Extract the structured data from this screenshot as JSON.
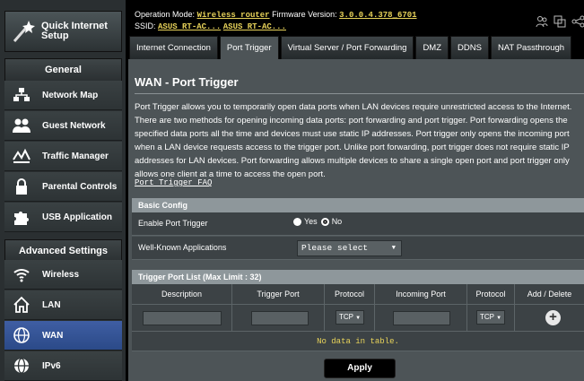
{
  "sidebar": {
    "quick_setup": "Quick Internet Setup",
    "general_heading": "General",
    "general_items": [
      {
        "label": "Network Map",
        "icon": "network-map-icon"
      },
      {
        "label": "Guest Network",
        "icon": "guest-network-icon"
      },
      {
        "label": "Traffic Manager",
        "icon": "traffic-manager-icon"
      },
      {
        "label": "Parental Controls",
        "icon": "lock-icon"
      },
      {
        "label": "USB Application",
        "icon": "puzzle-icon"
      }
    ],
    "advanced_heading": "Advanced Settings",
    "advanced_items": [
      {
        "label": "Wireless",
        "icon": "wifi-icon"
      },
      {
        "label": "LAN",
        "icon": "home-icon"
      },
      {
        "label": "WAN",
        "icon": "globe-icon",
        "active": true
      },
      {
        "label": "IPv6",
        "icon": "ipv6-globe-icon"
      }
    ]
  },
  "header": {
    "op_mode_label": "Operation Mode:",
    "op_mode_value": "Wireless router",
    "fw_label": "Firmware Version:",
    "fw_value": "3.0.0.4.378_6701",
    "ssid_label": "SSID:",
    "ssid_1": "ASUS RT-AC...",
    "ssid_2": "ASUS RT-AC..."
  },
  "tabs": [
    {
      "label": "Internet Connection"
    },
    {
      "label": "Port Trigger",
      "active": true
    },
    {
      "label": "Virtual Server / Port Forwarding"
    },
    {
      "label": "DMZ"
    },
    {
      "label": "DDNS"
    },
    {
      "label": "NAT Passthrough"
    }
  ],
  "page": {
    "title": "WAN - Port Trigger",
    "description": "Port Trigger allows you to temporarily open data ports when LAN devices require unrestricted access to the Internet. There are two methods for opening incoming data ports: port forwarding and port trigger. Port forwarding opens the specified data ports all the time and devices must use static IP addresses. Port trigger only opens the incoming port when a LAN device requests access to the trigger port. Unlike port forwarding, port trigger does not require static IP addresses for LAN devices. Port forwarding allows multiple devices to share a single open port and port trigger only allows one client at a time to access the open port.",
    "faq_link": "Port Trigger FAQ"
  },
  "basic_config": {
    "heading": "Basic Config",
    "enable_label": "Enable Port Trigger",
    "yes": "Yes",
    "no": "No",
    "selected": "No",
    "wk_label": "Well-Known Applications",
    "wk_value": "Please select"
  },
  "trigger_list": {
    "heading": "Trigger Port List (Max Limit : 32)",
    "columns": [
      "Description",
      "Trigger Port",
      "Protocol",
      "Incoming Port",
      "Protocol",
      "Add / Delete"
    ],
    "protocol_1": "TCP",
    "protocol_2": "TCP",
    "no_data": "No data in table."
  },
  "apply_label": "Apply"
}
